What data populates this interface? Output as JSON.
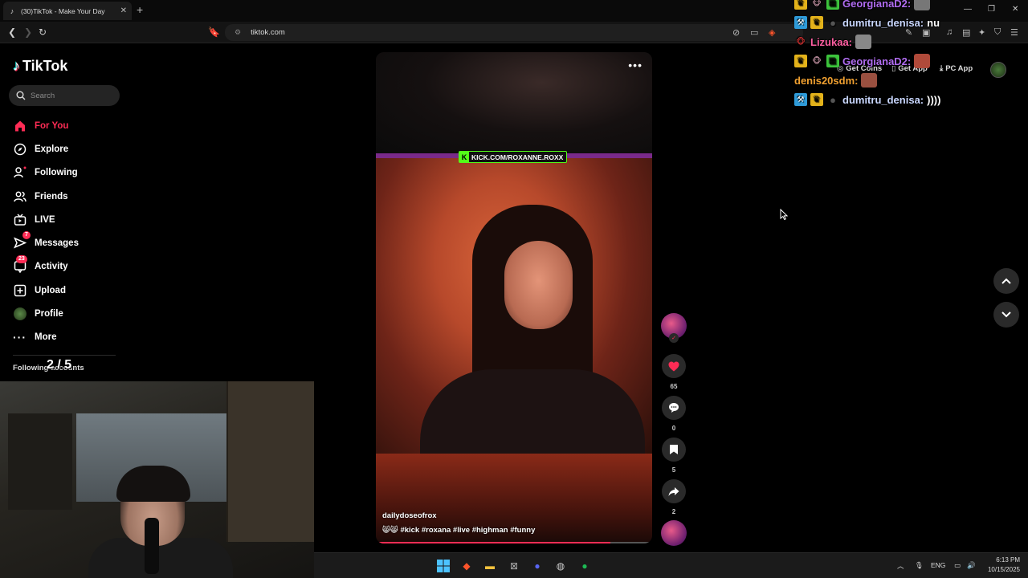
{
  "browser": {
    "tab_title": "(30)TikTok - Make Your Day",
    "url": "tiktok.com"
  },
  "sidebar": {
    "brand": "TikTok",
    "search_placeholder": "Search",
    "items": [
      {
        "label": "For You",
        "icon": "home-icon",
        "active": true
      },
      {
        "label": "Explore",
        "icon": "compass-icon"
      },
      {
        "label": "Following",
        "icon": "following-icon"
      },
      {
        "label": "Friends",
        "icon": "friends-icon"
      },
      {
        "label": "LIVE",
        "icon": "live-icon"
      },
      {
        "label": "Messages",
        "icon": "messages-icon",
        "badge": "7"
      },
      {
        "label": "Activity",
        "icon": "activity-icon",
        "badge": "23"
      },
      {
        "label": "Upload",
        "icon": "upload-icon"
      },
      {
        "label": "Profile",
        "icon": "profile-avatar"
      },
      {
        "label": "More",
        "icon": "more-icon"
      }
    ],
    "following_accounts_label": "Following accounts"
  },
  "overlay": {
    "counter": "2 / 5"
  },
  "header": {
    "get_coins": "Get Coins",
    "get_app": "Get App",
    "pc_app": "PC App"
  },
  "video": {
    "kick_banner": "KICK.COM/ROXANNE.ROXX",
    "author": "dailydoseofrox",
    "caption": "😸😸 #kick #roxana #live #highman #funny",
    "progress": 0.85
  },
  "actions": {
    "likes": "65",
    "comments": "0",
    "saves": "5",
    "shares": "2"
  },
  "chat": [
    {
      "user": "GeorgianaD2:",
      "msg": "",
      "color": "#b06cf0"
    },
    {
      "user": "dumitru_denisa:",
      "msg": "nu",
      "color": "#c9d7ff"
    },
    {
      "user": "Lizukaa:",
      "msg": "",
      "color": "#ff5fa2"
    },
    {
      "user": "GeorgianaD2:",
      "msg": "",
      "color": "#b06cf0"
    },
    {
      "user": "denis20sdm:",
      "msg": "",
      "color": "#f0a030"
    },
    {
      "user": "dumitru_denisa:",
      "msg": "))))",
      "color": "#c9d7ff"
    }
  ],
  "taskbar": {
    "lang": "ENG",
    "time": "6:13 PM",
    "date": "10/15/2025"
  }
}
